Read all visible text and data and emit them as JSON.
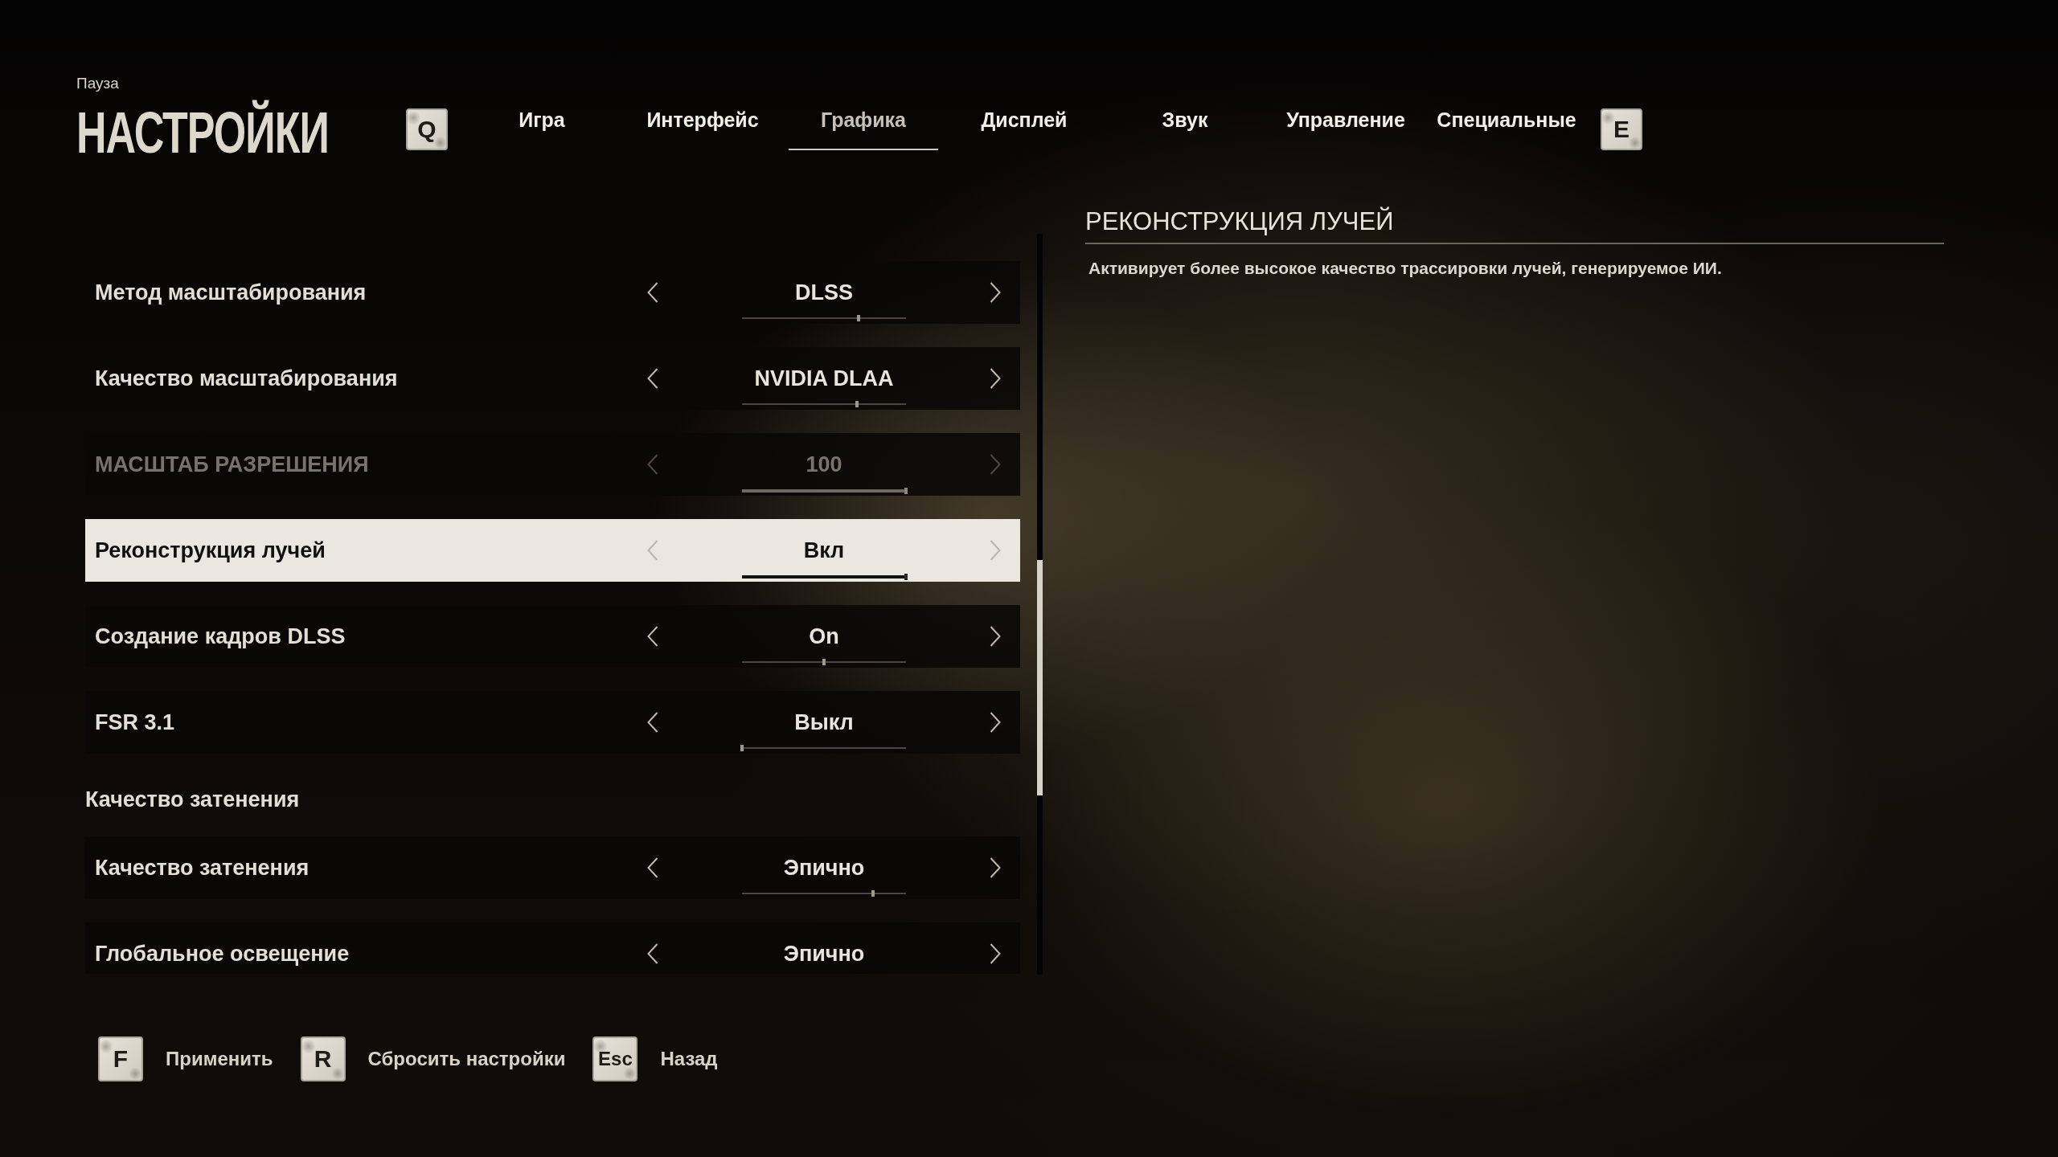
{
  "header": {
    "breadcrumb": "Пауза",
    "title": "НАСТРОЙКИ"
  },
  "tab_bar": {
    "prev_key": "Q",
    "next_key": "E",
    "tabs": [
      {
        "label": "Игра",
        "selected": false
      },
      {
        "label": "Интерфейс",
        "selected": false
      },
      {
        "label": "Графика",
        "selected": true
      },
      {
        "label": "Дисплей",
        "selected": false
      },
      {
        "label": "Звук",
        "selected": false
      },
      {
        "label": "Управление",
        "selected": false
      },
      {
        "label": "Специальные",
        "selected": false
      }
    ]
  },
  "settings": [
    {
      "kind": "setting",
      "label": "Метод масштабирования",
      "value": "DLSS",
      "disabled": false,
      "selected": false,
      "level": 0.71
    },
    {
      "kind": "setting",
      "label": "Качество масштабирования",
      "value": "NVIDIA DLAA",
      "disabled": false,
      "selected": false,
      "level": 0.7
    },
    {
      "kind": "setting",
      "label": "МАСШТАБ РАЗРЕШЕНИЯ",
      "value": "100",
      "disabled": true,
      "selected": false,
      "level": 1
    },
    {
      "kind": "setting",
      "label": "Реконструкция лучей",
      "value": "Вкл",
      "disabled": false,
      "selected": true,
      "level": 1
    },
    {
      "kind": "setting",
      "label": "Создание кадров DLSS",
      "value": "On",
      "disabled": false,
      "selected": false,
      "level": 0.5
    },
    {
      "kind": "setting",
      "label": "FSR 3.1",
      "value": "Выкл",
      "disabled": false,
      "selected": false,
      "level": 0
    },
    {
      "kind": "header",
      "label": "Качество затенения"
    },
    {
      "kind": "setting",
      "label": "Качество затенения",
      "value": "Эпично",
      "disabled": false,
      "selected": false,
      "level": 0.8
    },
    {
      "kind": "setting",
      "label": "Глобальное освещение",
      "value": "Эпично",
      "disabled": false,
      "selected": false
    }
  ],
  "description": {
    "title": "РЕКОНСТРУКЦИЯ ЛУЧЕЙ",
    "text": "Активирует более высокое качество трассировки лучей, генерируемое ИИ."
  },
  "footer_actions": [
    {
      "key": "F",
      "label": "Применить"
    },
    {
      "key": "R",
      "label": "Сбросить настройки"
    },
    {
      "key": "Esc",
      "label": "Назад"
    }
  ]
}
